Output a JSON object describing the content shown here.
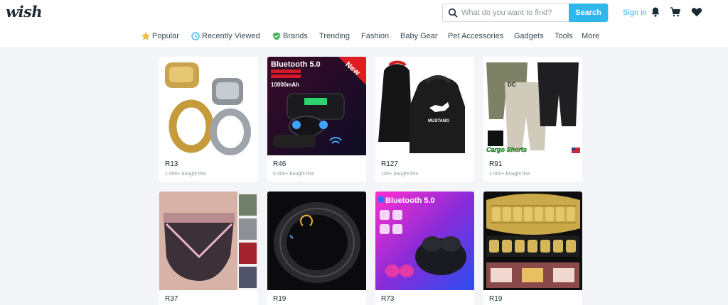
{
  "header": {
    "logo": "wish",
    "search_placeholder": "What do you want to find?",
    "search_button": "Search",
    "signin": "Sign in"
  },
  "nav": {
    "items": [
      "Popular",
      "Recently Viewed",
      "Brands",
      "Trending",
      "Fashion",
      "Baby Gear",
      "Pet Accessories",
      "Gadgets",
      "Tools",
      "More"
    ]
  },
  "products": [
    {
      "price": "R13",
      "sold": "1 000+ bought this"
    },
    {
      "price": "R46",
      "sold": "5 000+ bought this",
      "image_text": [
        "Bluetooth 5.0",
        "New",
        "10000mAh"
      ]
    },
    {
      "price": "R127",
      "sold": "100+ bought this",
      "image_text": [
        "MUSTANG"
      ]
    },
    {
      "price": "R91",
      "sold": "1 000+ bought this",
      "image_text": [
        "Cargo Shorts",
        "DC"
      ]
    },
    {
      "price": "R37",
      "sold": ""
    },
    {
      "price": "R19",
      "sold": ""
    },
    {
      "price": "R73",
      "sold": "",
      "image_text": [
        "Bluetooth 5.0"
      ]
    },
    {
      "price": "R19",
      "sold": ""
    }
  ],
  "colors": {
    "accent": "#2fb7ec",
    "background": "#f3f5f9"
  }
}
